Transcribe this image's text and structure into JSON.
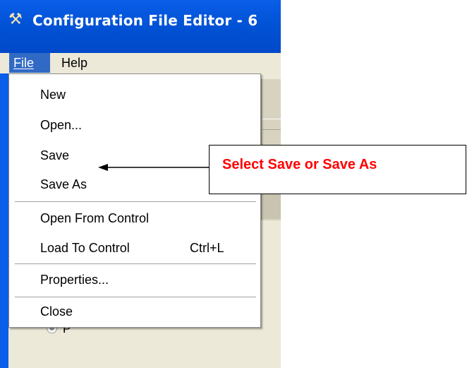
{
  "window": {
    "title": "Configuration File Editor - 6",
    "title_icon": "tools-icon"
  },
  "menubar": {
    "file_label": "File",
    "help_label": "Help"
  },
  "file_menu": {
    "items": [
      {
        "label": "New",
        "shortcut": ""
      },
      {
        "label": "Open...",
        "shortcut": ""
      },
      {
        "label": "Save",
        "shortcut": ""
      },
      {
        "label": "Save As",
        "shortcut": ""
      },
      {
        "label": "Open From Control",
        "shortcut": ""
      },
      {
        "label": "Load To Control",
        "shortcut": "Ctrl+L"
      },
      {
        "label": "Properties...",
        "shortcut": ""
      },
      {
        "label": "Close",
        "shortcut": ""
      }
    ]
  },
  "background": {
    "radio_label": "P"
  },
  "callout": {
    "text": "Select Save or Save As",
    "color": "#ff0000"
  },
  "colors": {
    "titlebar": "#0a5ee8",
    "menu_highlight": "#316ac5",
    "window_bg": "#ece9d8"
  }
}
